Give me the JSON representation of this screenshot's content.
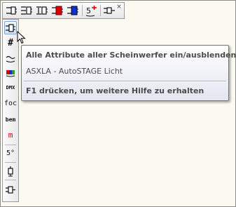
{
  "horizontal_toolbar": {
    "buttons": [
      {
        "icon": "light-insert-icon"
      },
      {
        "icon": "light-insert-attributes-icon"
      },
      {
        "icon": "light-insert-text-icon"
      },
      {
        "icon": "light-red-icon"
      },
      {
        "icon": "light-blue-icon"
      },
      {
        "icon": "5-degree-plus-icon"
      },
      {
        "icon": "light-small-icon"
      }
    ],
    "close_glyph": "×"
  },
  "vertical_toolbar": {
    "buttons": [
      {
        "icon": "light-toggle-icon",
        "active": true
      },
      {
        "icon": "hash-icon",
        "label": "#"
      },
      {
        "icon": "wave-icon",
        "label": "~"
      },
      {
        "icon": "color-bar-icon"
      },
      {
        "icon": "dmx-icon",
        "label": "DMX"
      },
      {
        "icon": "focus-icon",
        "label": "foc"
      },
      {
        "icon": "bem-icon",
        "label": "bem"
      },
      {
        "icon": "m-icon",
        "label": "m"
      },
      {
        "icon": "angle-icon",
        "label": "5°"
      },
      {
        "icon": "spot-icon"
      },
      {
        "icon": "light-small-icon"
      }
    ]
  },
  "tooltip": {
    "title": "Alle Attribute aller Scheinwerfer ein/ausblenden",
    "description": "ASXLA - AutoSTAGE Licht",
    "help": "F1 drücken, um weitere Hilfe zu erhalten"
  },
  "colors": {
    "background": "#fbfaf0",
    "tooltip_text": "#4c4c4c",
    "active_button": "#cfe4fa"
  }
}
